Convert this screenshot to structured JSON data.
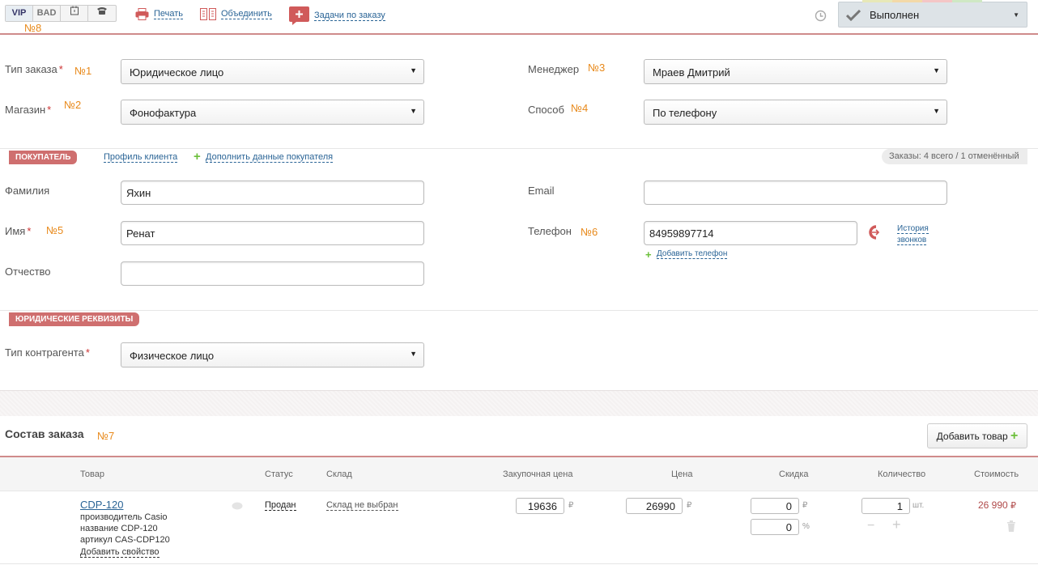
{
  "topbar": {
    "seg": [
      "VIP",
      "BAD"
    ],
    "print": "Печать",
    "merge": "Объединить",
    "tasks": "Задачи по заказу",
    "status": "Выполнен"
  },
  "notes": {
    "n1": "№1",
    "n2": "№2",
    "n3": "№3",
    "n4": "№4",
    "n5": "№5",
    "n6": "№6",
    "n7": "№7",
    "n8": "№8"
  },
  "form": {
    "order_type_label": "Тип заказа",
    "order_type_value": "Юридическое лицо",
    "shop_label": "Магазин",
    "shop_value": "Фонофактура",
    "manager_label": "Менеджер",
    "manager_value": "Мраев Дмитрий",
    "method_label": "Способ",
    "method_value": "По телефону"
  },
  "buyer": {
    "tag": "ПОКУПАТЕЛЬ",
    "profile_link": "Профиль клиента",
    "add_data_link": "Дополнить данные покупателя",
    "orders_info": "Заказы: 4 всего / 1 отменённый",
    "lastname_label": "Фамилия",
    "lastname_value": "Яхин",
    "name_label": "Имя",
    "name_value": "Ренат",
    "patronymic_label": "Отчество",
    "patronymic_value": "",
    "email_label": "Email",
    "email_value": "",
    "phone_label": "Телефон",
    "phone_value": "84959897714",
    "call_history": "История звонков",
    "add_phone": "Добавить телефон"
  },
  "legal": {
    "tag": "ЮРИДИЧЕСКИЕ РЕКВИЗИТЫ",
    "contractor_label": "Тип контрагента",
    "contractor_value": "Физическое лицо"
  },
  "order": {
    "title": "Состав заказа",
    "add_button": "Добавить товар",
    "columns": [
      "Товар",
      "Статус",
      "Склад",
      "Закупочная цена",
      "Цена",
      "Скидка",
      "Количество",
      "Стоимость"
    ],
    "item": {
      "name": "CDP-120",
      "props": [
        "производитель Casio",
        "название CDP-120",
        "артикул CAS-CDP120"
      ],
      "add_prop": "Добавить свойство",
      "status": "Продан",
      "warehouse": "Склад не выбран",
      "purchase_price": "19636",
      "price": "26990",
      "discount_abs": "0",
      "discount_pct": "0",
      "quantity": "1",
      "unit": "шт.",
      "total": "26 990",
      "currency": "₽",
      "percent": "%"
    }
  },
  "colors": {
    "accent": "#cf6f6f",
    "link": "#2a6496",
    "note": "#e8891a",
    "add_green": "#6bbf3a"
  }
}
